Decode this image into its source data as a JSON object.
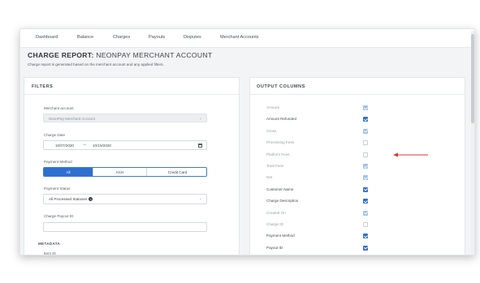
{
  "nav": {
    "items": [
      "Dashboard",
      "Balance",
      "Charges",
      "Payouts",
      "Disputes",
      "Merchant Accounts"
    ]
  },
  "header": {
    "title_bold": "CHARGE REPORT:",
    "title_rest": "NEONPAY MERCHANT ACCOUNT",
    "subtitle": "Charge report is generated based on the merchant account and any applied filters."
  },
  "filters": {
    "title": "FILTERS",
    "merchant_account_label": "Merchant account",
    "merchant_account_value": "NeonPay Merchant Account",
    "charge_date_label": "Charge Date",
    "date_from": "10/07/2020",
    "date_to": "10/19/2020",
    "payment_method_label": "Payment Method",
    "payment_methods": [
      "All",
      "ACH",
      "Credit Card"
    ],
    "payment_method_selected": "All",
    "status_label": "Payment Status",
    "status_value": "All Processed Statuses",
    "payout_id_label": "Charge Payout ID",
    "payout_id_value": "",
    "metadata_label": "METADATA",
    "item_id_label": "Item ID"
  },
  "output_columns": {
    "title": "OUTPUT COLUMNS",
    "columns": [
      {
        "label": "Amount",
        "state": "light"
      },
      {
        "label": "Amount Refunded",
        "state": "on"
      },
      {
        "label": "Gross",
        "state": "light"
      },
      {
        "label": "Processing Fees",
        "state": "off"
      },
      {
        "label": "Platform Fees",
        "state": "off"
      },
      {
        "label": "Total Fees",
        "state": "light"
      },
      {
        "label": "Net",
        "state": "light"
      },
      {
        "label": "Customer Name",
        "state": "on"
      },
      {
        "label": "Charge Description",
        "state": "on"
      },
      {
        "label": "Created On",
        "state": "light"
      },
      {
        "label": "Charge ID",
        "state": "off"
      },
      {
        "label": "Payment Method",
        "state": "on"
      },
      {
        "label": "Payout ID",
        "state": "on"
      }
    ]
  },
  "colors": {
    "accent": "#2f6fd0",
    "annotation_arrow": "#e0352b"
  },
  "icons": {
    "calendar": "calendar-icon",
    "clear": "clear-x-icon",
    "dropdown": "chevron-down-icon"
  }
}
